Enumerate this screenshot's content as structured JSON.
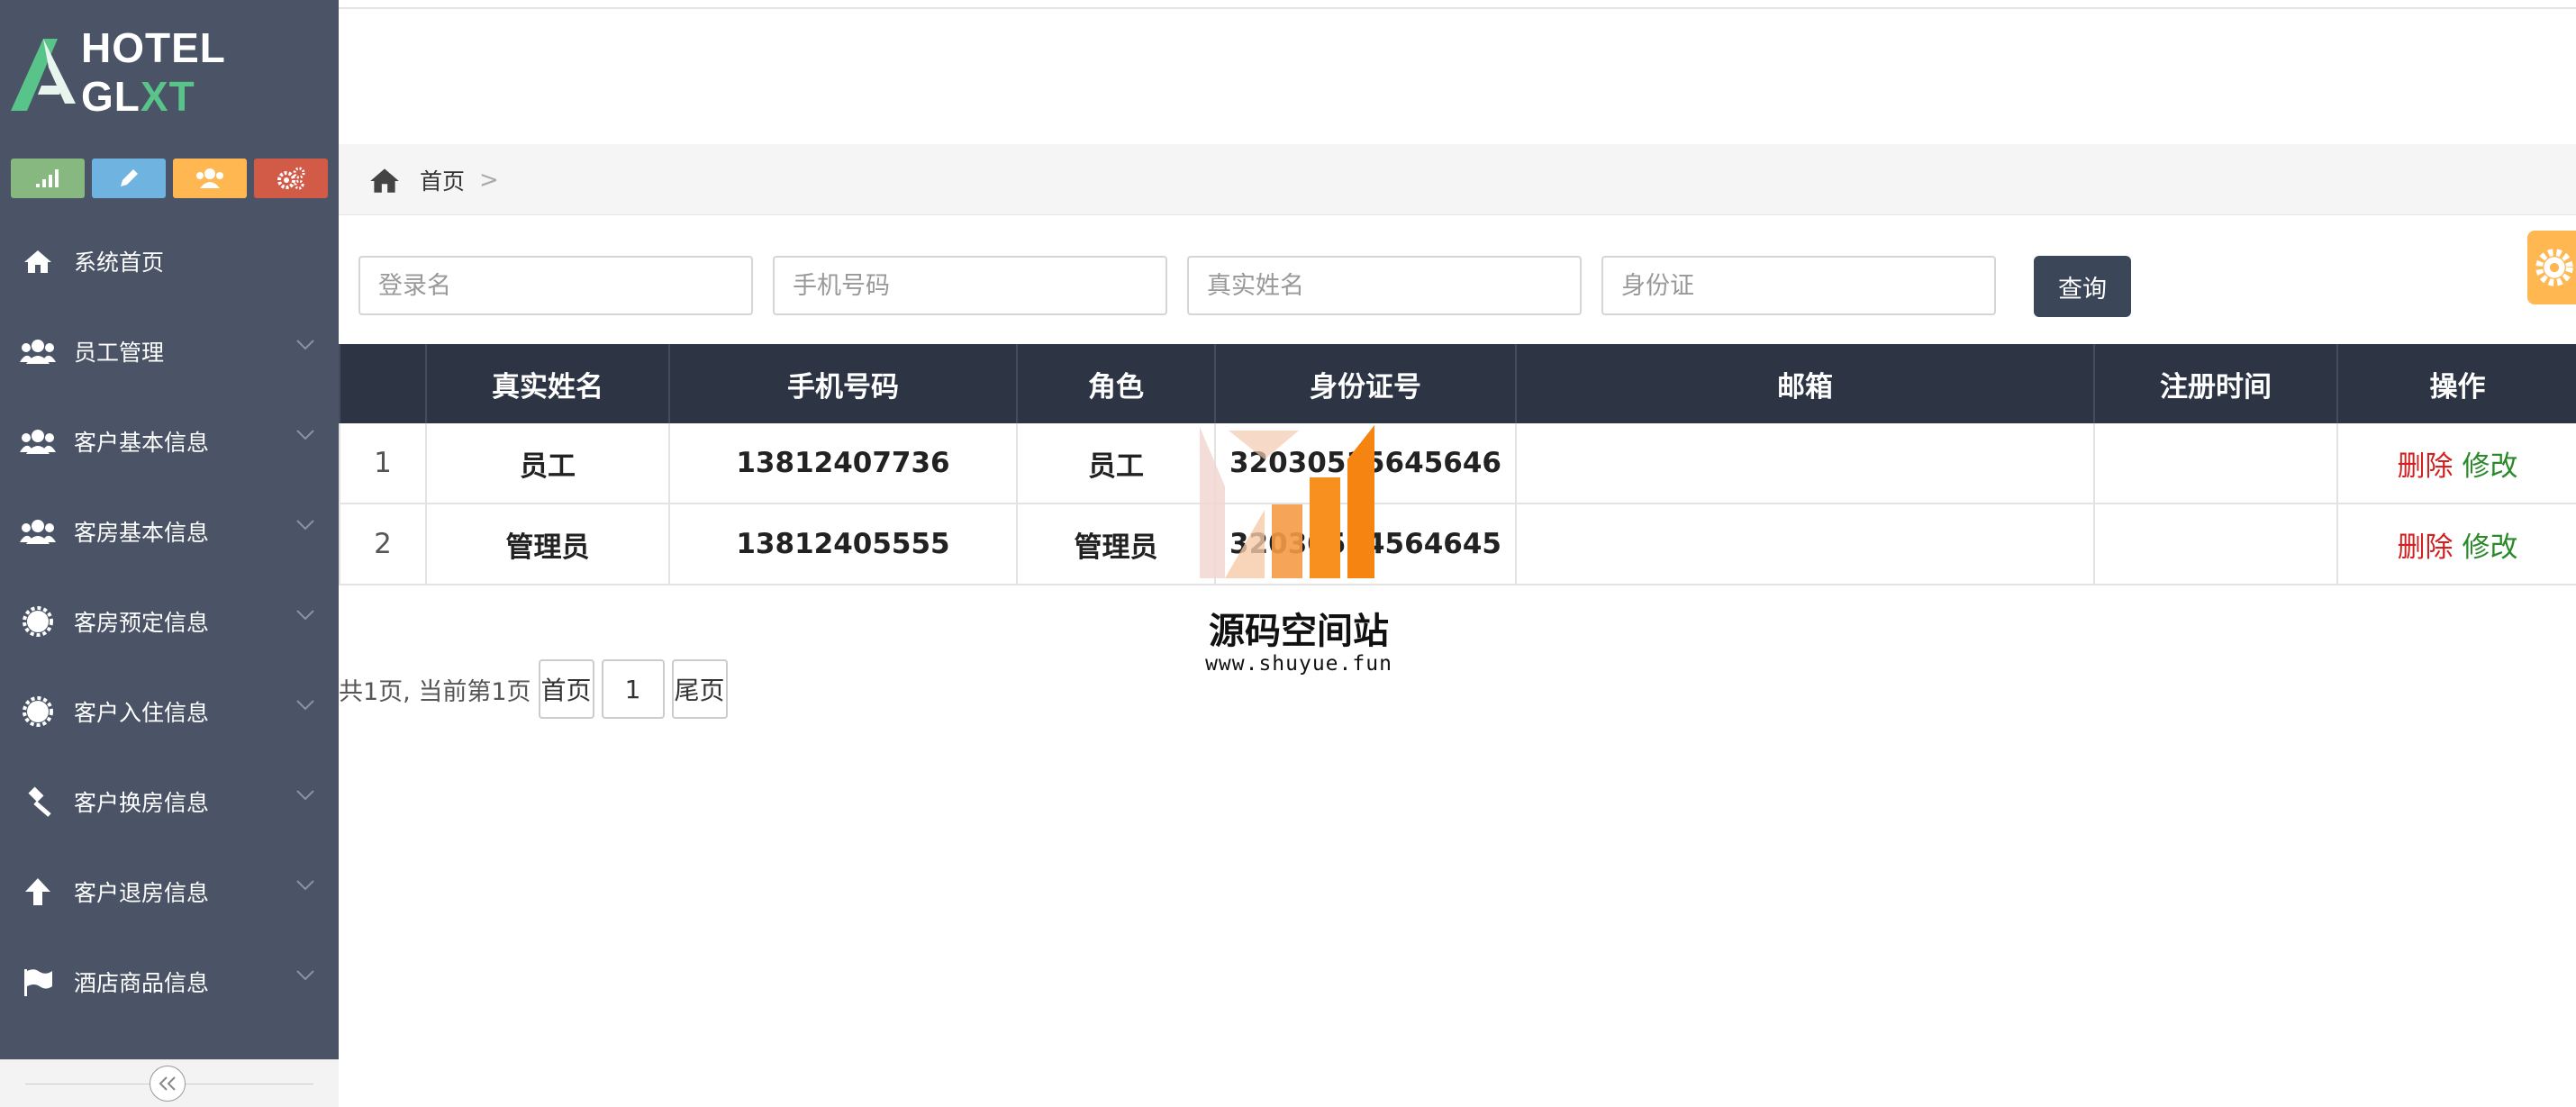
{
  "app": {
    "logo_text_main": "HOTEL GL",
    "logo_text_accent": "XT"
  },
  "colors": {
    "sidebar_bg": "#4a5466",
    "table_header_bg": "#2d3443",
    "query_button_bg": "#3c4659",
    "delete_color": "#d12020",
    "modify_color": "#2a8a2a"
  },
  "shortcuts": [
    {
      "icon": "signal-icon"
    },
    {
      "icon": "pencil-icon"
    },
    {
      "icon": "users-icon"
    },
    {
      "icon": "cogs-icon"
    }
  ],
  "sidebar": {
    "items": [
      {
        "label": "系统首页",
        "icon": "home-icon"
      },
      {
        "label": "员工管理",
        "icon": "users-icon"
      },
      {
        "label": "客户基本信息",
        "icon": "users-icon"
      },
      {
        "label": "客房基本信息",
        "icon": "users-icon"
      },
      {
        "label": "客房预定信息",
        "icon": "gear-icon"
      },
      {
        "label": "客户入住信息",
        "icon": "gear-icon"
      },
      {
        "label": "客户换房信息",
        "icon": "gavel-icon"
      },
      {
        "label": "客户退房信息",
        "icon": "arrow-up-icon"
      },
      {
        "label": "酒店商品信息",
        "icon": "flag-icon"
      }
    ]
  },
  "breadcrumb": {
    "home": "首页",
    "separator": ">"
  },
  "search": {
    "login_placeholder": "登录名",
    "phone_placeholder": "手机号码",
    "realname_placeholder": "真实姓名",
    "idcard_placeholder": "身份证",
    "query_label": "查询"
  },
  "table": {
    "headers": [
      "",
      "真实姓名",
      "手机号码",
      "角色",
      "身份证号",
      "邮箱",
      "注册时间",
      "操作"
    ],
    "rows": [
      {
        "index": "1",
        "name": "员工",
        "phone": "13812407736",
        "role": "员工",
        "idcard": "32030515645646",
        "email": "",
        "reg_time": "",
        "delete": "删除",
        "modify": "修改"
      },
      {
        "index": "2",
        "name": "管理员",
        "phone": "13812405555",
        "role": "管理员",
        "idcard": "32030564564645",
        "email": "",
        "reg_time": "",
        "delete": "删除",
        "modify": "修改"
      }
    ]
  },
  "pager": {
    "info": "共1页, 当前第1页",
    "first": "首页",
    "page": "1",
    "last": "尾页"
  },
  "watermark": {
    "title": "源码空间站",
    "url": "www.shuyue.fun"
  }
}
